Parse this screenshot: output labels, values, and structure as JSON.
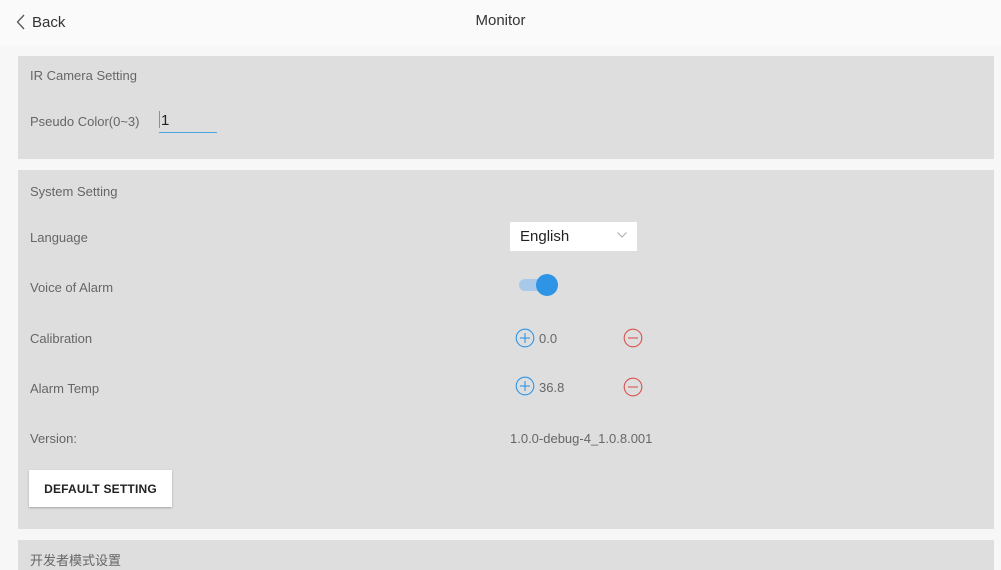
{
  "header": {
    "back_label": "Back",
    "title": "Monitor"
  },
  "ir_camera": {
    "section_title": "IR Camera Setting",
    "pseudo_color_label": "Pseudo Color(0~3)",
    "pseudo_color_value": "1"
  },
  "system": {
    "section_title": "System Setting",
    "language_label": "Language",
    "language_value": "English",
    "voice_label": "Voice of Alarm",
    "voice_on": true,
    "calibration_label": "Calibration",
    "calibration_value": "0.0",
    "alarm_temp_label": "Alarm Temp",
    "alarm_temp_value": "36.8",
    "version_label": "Version:",
    "version_value": "1.0.0-debug-4_1.0.8.001",
    "default_button": "DEFAULT SETTING"
  },
  "developer": {
    "section_title": "开发者模式设置"
  },
  "colors": {
    "accent": "#2e95e6",
    "minus": "#d9534f",
    "panel": "#dedede"
  },
  "icons": {
    "back": "chevron-left-icon",
    "plus": "plus-circle-icon",
    "minus": "minus-circle-icon",
    "dropdown": "chevron-down-icon"
  }
}
